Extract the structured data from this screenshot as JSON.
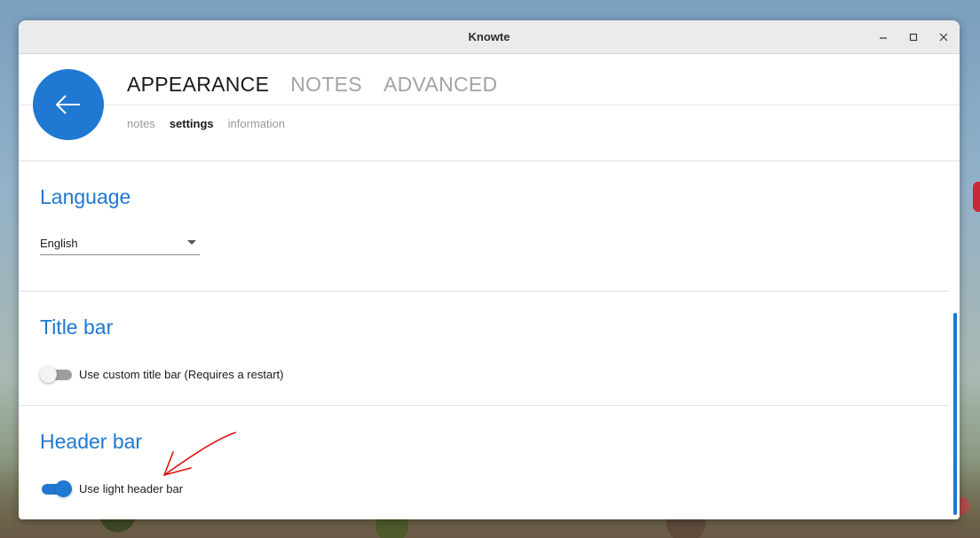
{
  "window": {
    "title": "Knowte"
  },
  "header": {
    "tabs": [
      {
        "label": "APPEARANCE",
        "active": true
      },
      {
        "label": "NOTES",
        "active": false
      },
      {
        "label": "ADVANCED",
        "active": false
      }
    ],
    "subtabs": [
      {
        "label": "notes",
        "active": false
      },
      {
        "label": "settings",
        "active": true
      },
      {
        "label": "information",
        "active": false
      }
    ]
  },
  "sections": {
    "language": {
      "title": "Language",
      "selected": "English"
    },
    "title_bar": {
      "title": "Title bar",
      "toggle_label": "Use custom title bar (Requires a restart)",
      "toggle_on": false
    },
    "header_bar": {
      "title": "Header bar",
      "toggle_label": "Use light header bar",
      "toggle_on": true
    }
  },
  "colors": {
    "accent": "#1f78d1",
    "annotation": "#e01010"
  },
  "icons": {
    "back": "arrow-left-icon",
    "minimize": "minimize-icon",
    "maximize": "maximize-icon",
    "close": "close-icon",
    "dropdown": "caret-down-icon",
    "annotation": "red-arrow-annotation"
  }
}
